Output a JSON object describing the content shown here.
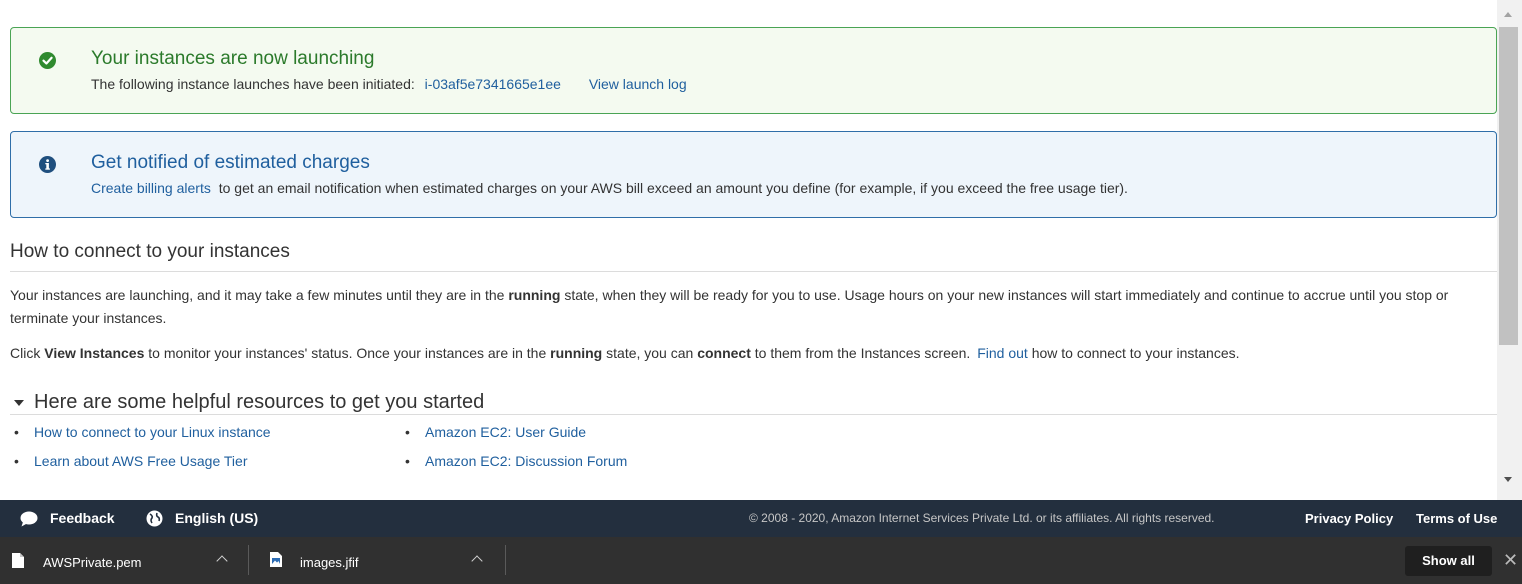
{
  "launch_alert": {
    "title": "Your instances are now launching",
    "body_prefix": "The following instance launches have been initiated:",
    "instance_id": "i-03af5e7341665e1ee",
    "view_log_link": "View launch log",
    "color": "#4aa454"
  },
  "billing_alert": {
    "title": "Get notified of estimated charges",
    "link": "Create billing alerts",
    "body": "to get an email notification when estimated charges on your AWS bill exceed an amount you define (for example, if you exceed the free usage tier).",
    "color": "#1f5f9e"
  },
  "connect_section": {
    "heading": "How to connect to your instances",
    "para1": {
      "a": "Your instances are launching, and it may take a few minutes until they are in the",
      "b": "running",
      "c": "state, when they will be ready for you to use. Usage hours on your new instances will start immediately and continue to accrue until you stop or terminate your instances."
    },
    "para2": {
      "a": "Click",
      "b": "View Instances",
      "c": "to monitor your instances' status. Once your instances are in the",
      "d": "running",
      "e": "state, you can",
      "f": "connect",
      "g": "to them from the Instances screen.",
      "link": "Find out",
      "h": "how to connect to your instances."
    }
  },
  "resources": {
    "heading": "Here are some helpful resources to get you started",
    "left": [
      "How to connect to your Linux instance",
      "Learn about AWS Free Usage Tier"
    ],
    "right": [
      "Amazon EC2: User Guide",
      "Amazon EC2: Discussion Forum"
    ]
  },
  "footer": {
    "feedback": "Feedback",
    "language": "English (US)",
    "copyright": "© 2008 - 2020, Amazon Internet Services Private Ltd. or its affiliates. All rights reserved.",
    "privacy": "Privacy Policy",
    "terms": "Terms of Use",
    "bg_color": "#232f3e"
  },
  "downloads": {
    "items": [
      {
        "name": "AWSPrivate.pem",
        "icon": "file-icon"
      },
      {
        "name": "images.jfif",
        "icon": "image-file-icon"
      }
    ],
    "show_all": "Show all",
    "close": "✕"
  }
}
